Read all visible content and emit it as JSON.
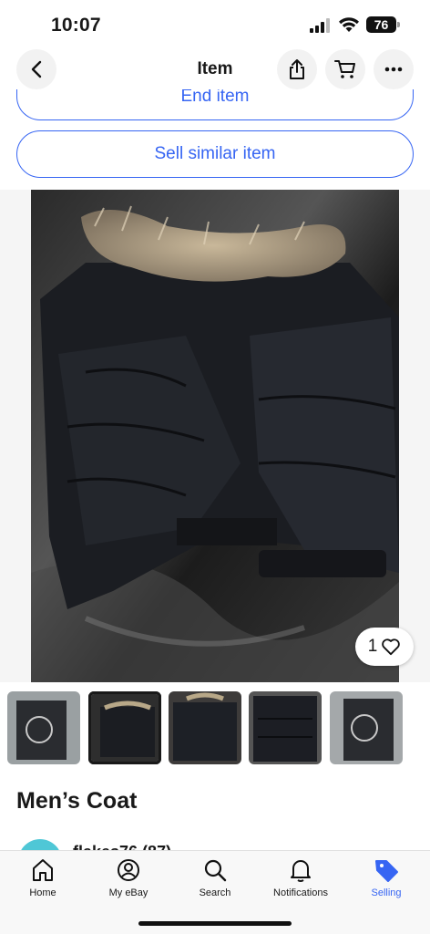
{
  "status": {
    "time": "10:07",
    "battery": "76"
  },
  "header": {
    "title": "Item"
  },
  "actions": {
    "end_item": "End item",
    "sell_similar": "Sell similar item"
  },
  "gallery": {
    "like_count": "1"
  },
  "item": {
    "title": "Men’s Coat"
  },
  "seller": {
    "name": "flakes76 (87)"
  },
  "tabs": [
    {
      "label": "Home",
      "icon": "home-icon"
    },
    {
      "label": "My eBay",
      "icon": "my-ebay-icon"
    },
    {
      "label": "Search",
      "icon": "search-icon"
    },
    {
      "label": "Notifications",
      "icon": "bell-icon"
    },
    {
      "label": "Selling",
      "icon": "tag-icon",
      "active": true
    }
  ],
  "colors": {
    "accent": "#3665f3",
    "text": "#191919",
    "button_bg": "#f2f2f2"
  }
}
